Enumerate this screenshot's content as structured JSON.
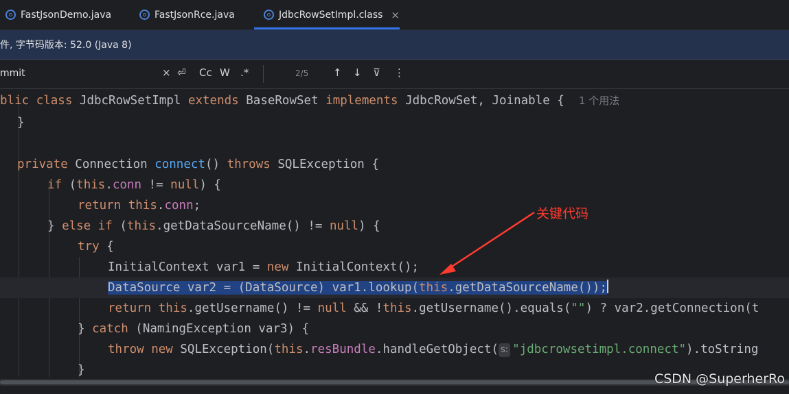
{
  "tabs": [
    {
      "label": "FastJsonDemo.java",
      "icon": "java-class-icon",
      "active": false
    },
    {
      "label": "FastJsonRce.java",
      "icon": "java-class-icon",
      "active": false
    },
    {
      "label": "JdbcRowSetImpl.class",
      "icon": "class-file-icon",
      "active": true,
      "close": "×"
    }
  ],
  "infobar": {
    "text": "件, 字节码版本: 52.0 (Java 8)"
  },
  "search": {
    "query": "mmit",
    "clear": "×",
    "tools": [
      "⏎",
      "Cc",
      "W",
      ".*"
    ],
    "match_count": "2/5",
    "nav": [
      "↑",
      "↓"
    ],
    "filter": "⊽",
    "more": "⋮"
  },
  "code": {
    "l1": {
      "a": "blic ",
      "b": "class ",
      "c": "JdbcRowSetImpl ",
      "d": "extends ",
      "e": "BaseRowSet ",
      "f": "implements ",
      "g": "JdbcRowSet, Joinable {  ",
      "hint": "1 个用法"
    },
    "l2": {
      "a": "}"
    },
    "l4": {
      "a": "private ",
      "b": "Connection ",
      "c": "connect",
      "d": "() ",
      "e": "throws ",
      "f": "SQLException {"
    },
    "l5": {
      "a": "if ",
      "b": "(",
      "c": "this",
      "d": ".",
      "e": "conn",
      "f": " != ",
      "g": "null",
      "h": ") {"
    },
    "l6": {
      "a": "return ",
      "b": "this",
      "c": ".",
      "d": "conn",
      "e": ";"
    },
    "l7": {
      "a": "} ",
      "b": "else if ",
      "c": "(",
      "d": "this",
      "e": ".getDataSourceName() != ",
      "f": "null",
      "g": ") {"
    },
    "l8": {
      "a": "try ",
      "b": "{"
    },
    "l9": {
      "a": "InitialContext var1 = ",
      "b": "new ",
      "c": "InitialContext();"
    },
    "l10": {
      "a": "DataSource var2 = (DataSource) var1.lookup(",
      "b": "this",
      "c": ".getDataSourceName());"
    },
    "l11": {
      "a": "return ",
      "b": "this",
      "c": ".getUsername() != ",
      "d": "null ",
      "e": "&& !",
      "f": "this",
      "g": ".getUsername().equals(",
      "h": "\"\"",
      "i": ") ? var2.getConnection(t"
    },
    "l12": {
      "a": "} ",
      "b": "catch ",
      "c": "(NamingException var3) {"
    },
    "l13": {
      "a": "throw ",
      "b": "new ",
      "c": "SQLException(",
      "d": "this",
      "e": ".",
      "f": "resBundle",
      "g": ".handleGetObject(",
      "p": "s:",
      "h": "\"jdbcrowsetimpl.connect\"",
      "i": ").toString"
    },
    "l14": {
      "a": "}"
    }
  },
  "annotation": {
    "text": "关键代码",
    "color": "#ff3b30"
  },
  "watermark": "CSDN @SuperherRo",
  "colors": {
    "keyword": "#cf8e6d",
    "function": "#56a8f5",
    "field": "#c77dbb",
    "string": "#6aab73",
    "selection": "#214283",
    "accent": "#3574f0"
  }
}
